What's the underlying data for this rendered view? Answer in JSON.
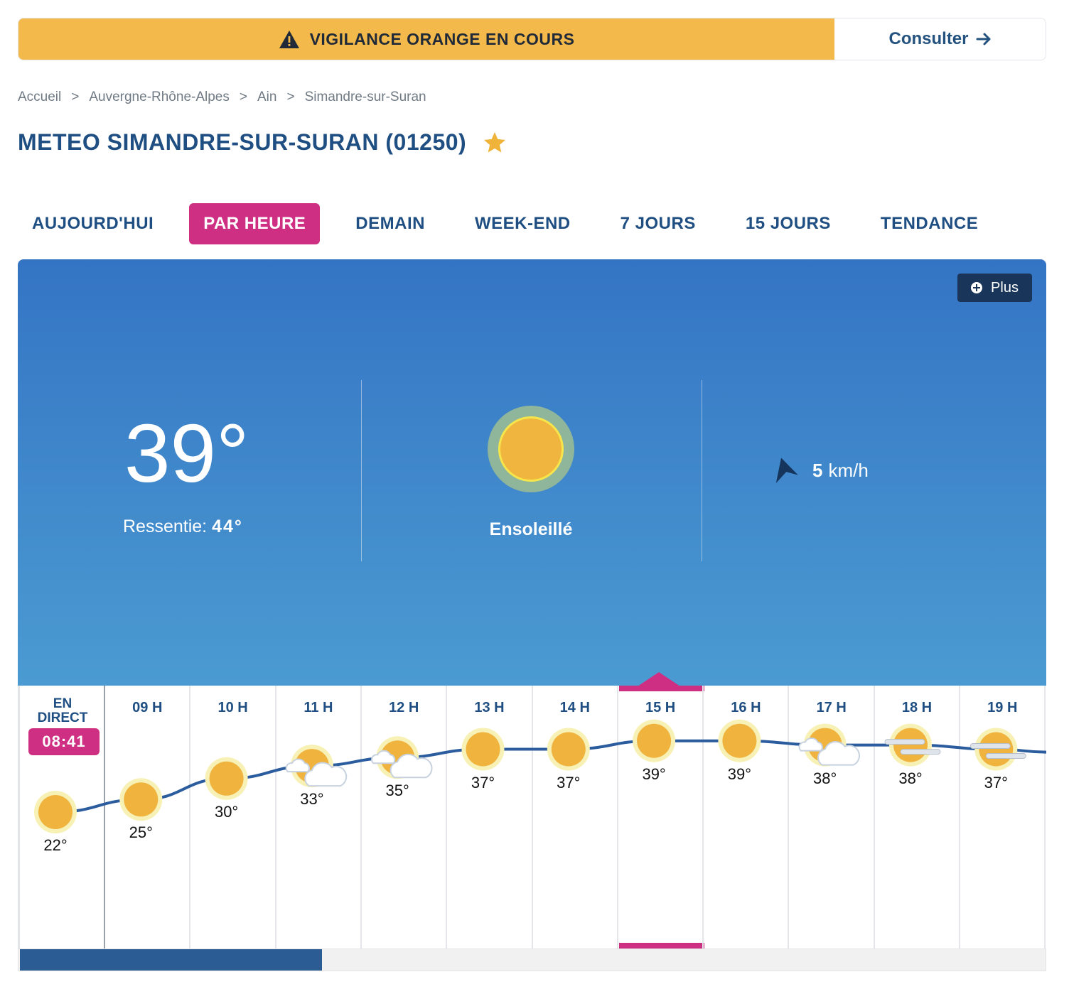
{
  "alert": {
    "text": "VIGILANCE ORANGE EN COURS",
    "button": "Consulter"
  },
  "breadcrumb": [
    "Accueil",
    "Auvergne-Rhône-Alpes",
    "Ain",
    "Simandre-sur-Suran"
  ],
  "breadcrumb_sep": ">",
  "title": "METEO SIMANDRE-SUR-SURAN (01250)",
  "tabs": [
    "AUJOURD'HUI",
    "PAR HEURE",
    "DEMAIN",
    "WEEK-END",
    "7 JOURS",
    "15 JOURS",
    "TENDANCE"
  ],
  "active_tab": "PAR HEURE",
  "current": {
    "plus_label": "Plus",
    "temperature": "39°",
    "feels_label": "Ressentie:",
    "feels_value": "44°",
    "condition": "Ensoleillé",
    "wind_value": "5",
    "wind_unit": "km/h"
  },
  "hourly": {
    "now_label_1": "EN",
    "now_label_2": "DIRECT",
    "now_time": "08:41",
    "hours": [
      {
        "label": "",
        "temp": "22°",
        "value": 22,
        "icon": "sun-icon"
      },
      {
        "label": "09 H",
        "temp": "25°",
        "value": 25,
        "icon": "sun-icon"
      },
      {
        "label": "10 H",
        "temp": "30°",
        "value": 30,
        "icon": "sun-icon"
      },
      {
        "label": "11 H",
        "temp": "33°",
        "value": 33,
        "icon": "sun-cloud-icon"
      },
      {
        "label": "12 H",
        "temp": "35°",
        "value": 35,
        "icon": "sun-cloud-icon"
      },
      {
        "label": "13 H",
        "temp": "37°",
        "value": 37,
        "icon": "sun-icon"
      },
      {
        "label": "14 H",
        "temp": "37°",
        "value": 37,
        "icon": "sun-icon"
      },
      {
        "label": "15 H",
        "temp": "39°",
        "value": 39,
        "icon": "sun-icon"
      },
      {
        "label": "16 H",
        "temp": "39°",
        "value": 39,
        "icon": "sun-icon"
      },
      {
        "label": "17 H",
        "temp": "38°",
        "value": 38,
        "icon": "sun-cloud-icon"
      },
      {
        "label": "18 H",
        "temp": "38°",
        "value": 38,
        "icon": "sun-haze-icon"
      },
      {
        "label": "19 H",
        "temp": "37°",
        "value": 37,
        "icon": "sun-haze-icon"
      }
    ],
    "selected_hour": "15 H"
  },
  "colors": {
    "accent": "#cf2f83",
    "alert": "#f4b94b",
    "primary": "#1f4f82",
    "curve": "#2b5c9e"
  }
}
